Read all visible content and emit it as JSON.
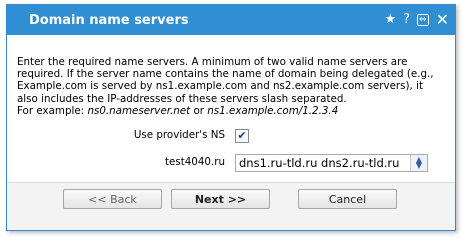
{
  "dialog": {
    "title": "Domain name servers",
    "icons": [
      "pin-icon",
      "help-icon",
      "resize-icon",
      "close-icon"
    ]
  },
  "description": {
    "text": "Enter the required name servers. A minimum of two valid name servers are required. If the server name contains the name of domain being delegated (e.g., Example.com is served by ns1.example.com and ns2.example.com servers), it also includes the IP-addresses of these servers slash separated.",
    "example_prefix": "For example: ",
    "example_1": "ns0.nameserver.net",
    "example_or": " or ",
    "example_2": "ns1.example.com/1.2.3.4"
  },
  "form": {
    "use_provider_ns_label": "Use provider's NS",
    "use_provider_ns_checked": true,
    "domain_label": "test4040.ru",
    "ns_value": "dns1.ru-tld.ru dns2.ru-tld.ru"
  },
  "buttons": {
    "back": "<< Back",
    "next": "Next >>",
    "cancel": "Cancel"
  },
  "colors": {
    "titlebar": "#2f8fd2",
    "checkmark": "#1a3c8c"
  }
}
